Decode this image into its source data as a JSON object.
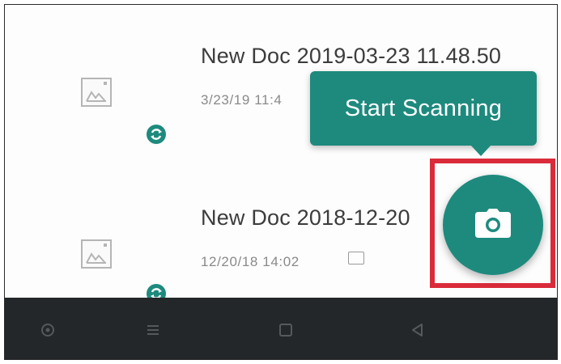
{
  "documents": [
    {
      "title": "New Doc 2019-03-23 11.48.50",
      "date": "3/23/19 11:4",
      "thumbnail_icon": "image-placeholder-icon",
      "status_icon": "sync-icon"
    },
    {
      "title": "New Doc 2018-12-20",
      "date": "12/20/18 14:02",
      "thumbnail_icon": "image-placeholder-icon",
      "status_icon": "sync-icon",
      "badge_icon": "page-count-icon"
    }
  ],
  "tooltip": {
    "text": "Start Scanning"
  },
  "fab": {
    "icon": "camera-icon"
  },
  "navbar": {
    "icons": [
      "circle-icon",
      "menu-icon",
      "square-icon",
      "back-triangle-icon"
    ]
  },
  "colors": {
    "accent": "#1e8a7e",
    "highlight": "#d92b3a",
    "navbar": "#23272a",
    "title_text": "#3c3c3c",
    "meta_text": "#8a8a8a"
  }
}
